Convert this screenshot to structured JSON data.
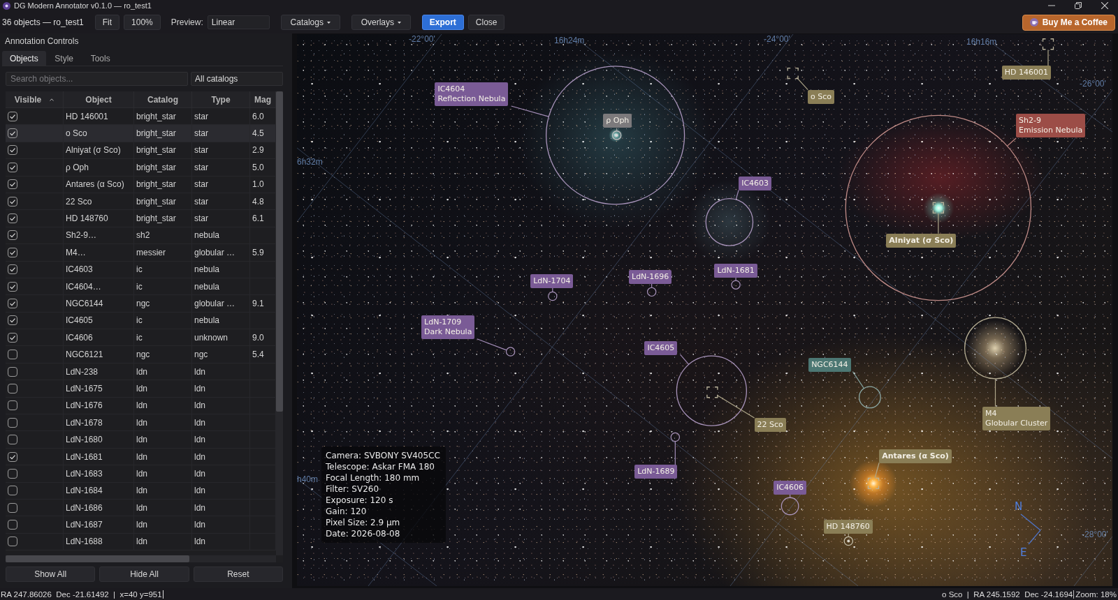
{
  "window": {
    "title": "DG Modern Annotator v0.1.0 — ro_test1"
  },
  "toolbar": {
    "items": [
      {
        "kind": "text",
        "label": "36 objects — ro_test1"
      },
      {
        "kind": "button",
        "label": "Fit"
      },
      {
        "kind": "button",
        "label": "100%"
      },
      {
        "kind": "label",
        "label": "Preview:"
      },
      {
        "kind": "field",
        "value": "Linear"
      },
      {
        "kind": "menu",
        "label": "Catalogs"
      },
      {
        "kind": "menu",
        "label": "Overlays"
      },
      {
        "kind": "primary",
        "label": "Export"
      },
      {
        "kind": "button",
        "label": "Close"
      }
    ],
    "support_button": "Buy Me a Coffee"
  },
  "left_panel": {
    "title": "Annotation Controls",
    "tabs": [
      {
        "label": "Objects",
        "selected": true
      },
      {
        "label": "Style",
        "selected": false
      },
      {
        "label": "Tools",
        "selected": false
      }
    ],
    "search": {
      "placeholder": "Search objects..."
    },
    "catalog_filter": {
      "value": "All catalogs"
    },
    "table": {
      "columns": [
        {
          "label": "Visible",
          "sorted": true
        },
        {
          "label": "Object",
          "sorted": false
        },
        {
          "label": "Catalog",
          "sorted": false
        },
        {
          "label": "Type",
          "sorted": false
        },
        {
          "label": "Mag",
          "sorted": false
        }
      ],
      "rows": [
        {
          "visible": true,
          "object": "HD 146001",
          "catalog": "bright_star",
          "type": "star",
          "mag": "6.0",
          "selected": false
        },
        {
          "visible": true,
          "object": "o Sco",
          "catalog": "bright_star",
          "type": "star",
          "mag": "4.5",
          "selected": true
        },
        {
          "visible": true,
          "object": "Alniyat (σ Sco)",
          "catalog": "bright_star",
          "type": "star",
          "mag": "2.9",
          "selected": false
        },
        {
          "visible": true,
          "object": "ρ Oph",
          "catalog": "bright_star",
          "type": "star",
          "mag": "5.0",
          "selected": false
        },
        {
          "visible": true,
          "object": "Antares (α Sco)",
          "catalog": "bright_star",
          "type": "star",
          "mag": "1.0",
          "selected": false
        },
        {
          "visible": true,
          "object": "22 Sco",
          "catalog": "bright_star",
          "type": "star",
          "mag": "4.8",
          "selected": false
        },
        {
          "visible": true,
          "object": "HD 148760",
          "catalog": "bright_star",
          "type": "star",
          "mag": "6.1",
          "selected": false
        },
        {
          "visible": true,
          "object": "Sh2-9…",
          "catalog": "sh2",
          "type": "nebula",
          "selected": false
        },
        {
          "visible": true,
          "object": "M4…",
          "catalog": "messier",
          "type": "globular …",
          "mag": "5.9",
          "selected": false
        },
        {
          "visible": true,
          "object": "IC4603",
          "catalog": "ic",
          "type": "nebula",
          "selected": false
        },
        {
          "visible": true,
          "object": "IC4604…",
          "catalog": "ic",
          "type": "nebula",
          "selected": false
        },
        {
          "visible": true,
          "object": "NGC6144",
          "catalog": "ngc",
          "type": "globular …",
          "mag": "9.1",
          "selected": false
        },
        {
          "visible": true,
          "object": "IC4605",
          "catalog": "ic",
          "type": "nebula",
          "selected": false
        },
        {
          "visible": true,
          "object": "IC4606",
          "catalog": "ic",
          "type": "unknown",
          "mag": "9.0",
          "selected": false
        },
        {
          "visible": false,
          "object": "NGC6121",
          "catalog": "ngc",
          "type": "ngc",
          "mag": "5.4",
          "selected": false
        },
        {
          "visible": false,
          "object": "LdN-238",
          "catalog": "ldn",
          "type": "ldn",
          "selected": false
        },
        {
          "visible": false,
          "object": "LdN-1675",
          "catalog": "ldn",
          "type": "ldn",
          "selected": false
        },
        {
          "visible": false,
          "object": "LdN-1676",
          "catalog": "ldn",
          "type": "ldn",
          "selected": false
        },
        {
          "visible": false,
          "object": "LdN-1678",
          "catalog": "ldn",
          "type": "ldn",
          "selected": false
        },
        {
          "visible": false,
          "object": "LdN-1680",
          "catalog": "ldn",
          "type": "ldn",
          "selected": false
        },
        {
          "visible": true,
          "object": "LdN-1681",
          "catalog": "ldn",
          "type": "ldn",
          "selected": false
        },
        {
          "visible": false,
          "object": "LdN-1683",
          "catalog": "ldn",
          "type": "ldn",
          "selected": false
        },
        {
          "visible": false,
          "object": "LdN-1684",
          "catalog": "ldn",
          "type": "ldn",
          "selected": false
        },
        {
          "visible": false,
          "object": "LdN-1686",
          "catalog": "ldn",
          "type": "ldn",
          "selected": false
        },
        {
          "visible": false,
          "object": "LdN-1687",
          "catalog": "ldn",
          "type": "ldn",
          "selected": false
        },
        {
          "visible": false,
          "object": "LdN-1688",
          "catalog": "ldn",
          "type": "ldn",
          "selected": false
        }
      ]
    },
    "buttons": [
      "Show All",
      "Hide All",
      "Reset"
    ]
  },
  "canvas": {
    "grid_labels": [
      "-22°00'",
      "16h24m",
      "-24°00'",
      "16h16m",
      "-26°00'",
      "6h32m",
      "h40m",
      "-28°00'"
    ],
    "annotations": [
      {
        "title": "IC4604",
        "subtitle": "Reflection Nebula",
        "kind": "region",
        "color": "#7a5b96",
        "highlight": false
      },
      {
        "title": "ρ Oph",
        "kind": "ring",
        "color": "#7c7a7c",
        "highlight": false
      },
      {
        "title": "o Sco",
        "kind": "star",
        "color": "#8a7e56",
        "highlight": false
      },
      {
        "title": "HD 146001",
        "kind": "star",
        "color": "#8a7e56",
        "highlight": false
      },
      {
        "title": "Sh2-9",
        "subtitle": "Emission Nebula",
        "kind": "region",
        "color": "#9c4d47",
        "highlight": false
      },
      {
        "title": "Alniyat (σ Sco)",
        "kind": "star",
        "color": "#8a7e56",
        "highlight": true
      },
      {
        "title": "IC4603",
        "kind": "region",
        "color": "#7a5b96",
        "highlight": false
      },
      {
        "title": "LdN-1681",
        "kind": "dark",
        "color": "#7a5b96",
        "highlight": false
      },
      {
        "title": "LdN-1696",
        "kind": "dark",
        "color": "#7a5b96",
        "highlight": false
      },
      {
        "title": "LdN-1704",
        "kind": "dark",
        "color": "#7a5b96",
        "highlight": false
      },
      {
        "title": "LdN-1709",
        "subtitle": "Dark Nebula",
        "kind": "dark",
        "color": "#7a5b96",
        "highlight": false
      },
      {
        "title": "IC4605",
        "kind": "region",
        "color": "#7a5b96",
        "highlight": false
      },
      {
        "title": "22 Sco",
        "kind": "star",
        "color": "#8a7e56",
        "highlight": false
      },
      {
        "title": "NGC6144",
        "kind": "region",
        "color": "#4c7773",
        "highlight": false
      },
      {
        "title": "M4",
        "subtitle": "Globular Cluster",
        "kind": "region",
        "color": "#8a7e56",
        "highlight": false
      },
      {
        "title": "LdN-1689",
        "kind": "dark",
        "color": "#7a5b96",
        "highlight": false
      },
      {
        "title": "Antares (α Sco)",
        "kind": "star",
        "color": "#8a7e56",
        "highlight": true
      },
      {
        "title": "IC4606",
        "kind": "region",
        "color": "#7a5b96",
        "highlight": false
      },
      {
        "title": "HD 148760",
        "kind": "ring",
        "color": "#8a7e56",
        "highlight": false
      }
    ],
    "info_box": {
      "lines": [
        "Camera: SVBONY SV405CC",
        "Telescope: Askar FMA 180",
        "Focal Length: 180 mm",
        "Filter: SV260",
        "Exposure: 120 s",
        "Gain: 120",
        "Pixel Size: 2.9 µm",
        "Date: 2026-08-08"
      ]
    },
    "compass": {
      "north": "N",
      "east": "E"
    }
  },
  "status_bar": {
    "cursor": "RA 247.86026  Dec -21.61492  |  x=40 y=951",
    "hover": "o Sco  |  RA 245.1592  Dec -24.1694",
    "zoom": "Zoom: 18%"
  }
}
